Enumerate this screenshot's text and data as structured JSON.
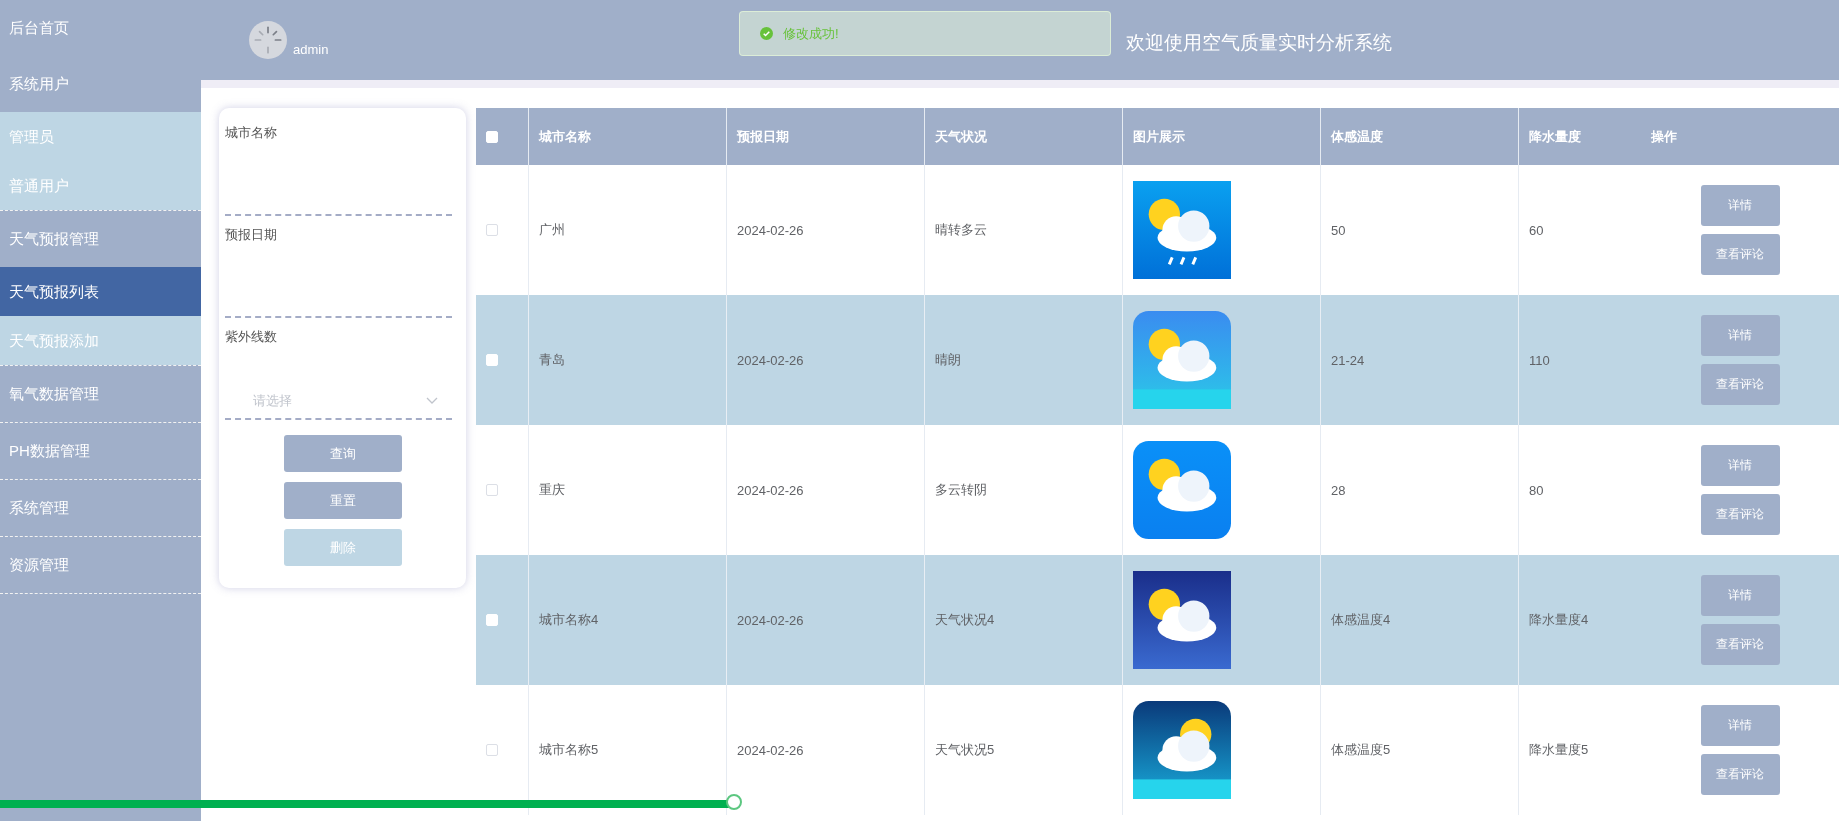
{
  "sidebar": {
    "items": [
      {
        "label": "后台首页",
        "selected": false
      },
      {
        "label": "系统用户",
        "selected": false,
        "children": [
          {
            "label": "管理员",
            "selected": false
          },
          {
            "label": "普通用户",
            "selected": false
          }
        ]
      },
      {
        "label": "天气预报管理",
        "selected": false,
        "children": [
          {
            "label": "天气预报列表",
            "selected": true
          },
          {
            "label": "天气预报添加",
            "selected": false
          }
        ]
      },
      {
        "label": "氧气数据管理",
        "selected": false
      },
      {
        "label": "PH数据管理",
        "selected": false
      },
      {
        "label": "系统管理",
        "selected": false
      },
      {
        "label": "资源管理",
        "selected": false
      }
    ]
  },
  "header": {
    "user": "admin",
    "title": "欢迎使用空气质量实时分析系统"
  },
  "toast": {
    "message": "修改成功!"
  },
  "filter": {
    "fields": [
      {
        "kind": "text",
        "label": "城市名称"
      },
      {
        "kind": "text",
        "label": "预报日期"
      },
      {
        "kind": "select",
        "label": "紫外线数",
        "placeholder": "请选择"
      }
    ],
    "buttons": [
      {
        "label": "查询",
        "disabled": false
      },
      {
        "label": "重置",
        "disabled": false
      },
      {
        "label": "删除",
        "disabled": true
      }
    ]
  },
  "table": {
    "columns": [
      "城市名称",
      "预报日期",
      "天气状况",
      "图片展示",
      "体感温度",
      "降水量度",
      "操作"
    ],
    "header_checked": false,
    "rows": [
      {
        "checked": false,
        "city": "广州",
        "date": "2024-02-26",
        "weather": "晴转多云",
        "feel": "50",
        "rain": "60",
        "actions": [
          "详情",
          "查看评论"
        ]
      },
      {
        "checked": false,
        "city": "青岛",
        "date": "2024-02-26",
        "weather": "晴朗",
        "feel": "21-24",
        "rain": "110",
        "actions": [
          "详情",
          "查看评论"
        ]
      },
      {
        "checked": false,
        "city": "重庆",
        "date": "2024-02-26",
        "weather": "多云转阴",
        "feel": "28",
        "rain": "80",
        "actions": [
          "详情",
          "查看评论"
        ]
      },
      {
        "checked": false,
        "city": "城市名称4",
        "date": "2024-02-26",
        "weather": "天气状况4",
        "feel": "体感温度4",
        "rain": "降水量度4",
        "actions": [
          "详情",
          "查看评论"
        ]
      },
      {
        "checked": false,
        "city": "城市名称5",
        "date": "2024-02-26",
        "weather": "天气状况5",
        "feel": "体感温度5",
        "rain": "降水量度5",
        "actions": [
          "详情",
          "查看评论"
        ]
      }
    ]
  },
  "video_progress": {
    "level": 0.4
  }
}
